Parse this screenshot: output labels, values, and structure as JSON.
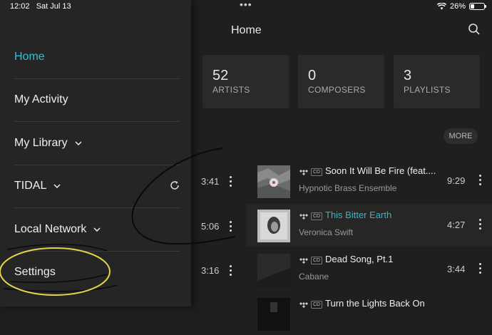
{
  "status_bar": {
    "time": "12:02",
    "date": "Sat Jul 13",
    "battery": "26%",
    "battery_level": 0.26
  },
  "header": {
    "title": "Home"
  },
  "stats": [
    {
      "number": "52",
      "label": "ARTISTS"
    },
    {
      "number": "0",
      "label": "COMPOSERS"
    },
    {
      "number": "3",
      "label": "PLAYLISTS"
    }
  ],
  "more_label": "MORE",
  "left_times": [
    "3:41",
    "5:06",
    "3:16"
  ],
  "tracks": [
    {
      "title": "Soon It Will Be Fire (feat....",
      "artist": "Hypnotic Brass Ensemble",
      "duration": "9:29",
      "badge": "CD"
    },
    {
      "title": "This Bitter Earth",
      "artist": "Veronica Swift",
      "duration": "4:27",
      "badge": "CD"
    },
    {
      "title": "Dead Song, Pt.1",
      "artist": "Cabane",
      "duration": "3:44",
      "badge": "CD"
    },
    {
      "title": "Turn the Lights Back On",
      "artist": "",
      "duration": "",
      "badge": "CD"
    }
  ],
  "menu": {
    "items": [
      {
        "label": "Home"
      },
      {
        "label": "My Activity"
      },
      {
        "label": "My Library"
      },
      {
        "label": "TIDAL"
      },
      {
        "label": "Local Network"
      },
      {
        "label": "Settings"
      }
    ]
  },
  "colors": {
    "accent": "#2fc3d1",
    "highlight_annotation": "#e5d34a"
  }
}
